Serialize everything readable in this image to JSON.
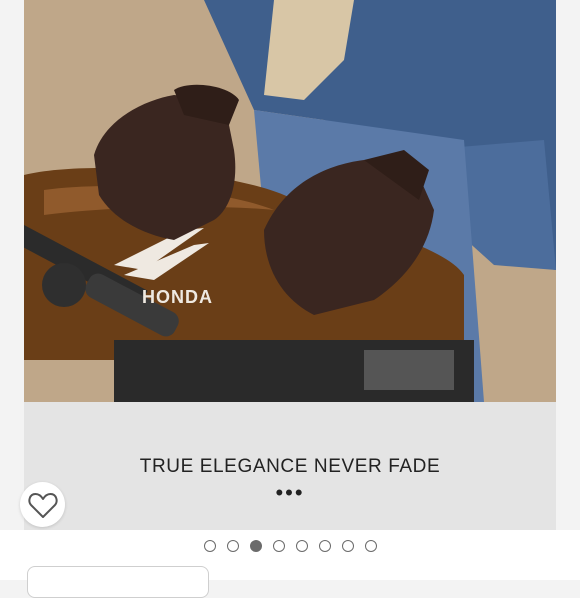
{
  "product": {
    "image": {
      "brand_text": "HONDA"
    },
    "caption": {
      "title": "TRUE ELEGANCE NEVER FADE",
      "more": "•••"
    },
    "favorite_icon": "heart-outline-icon",
    "carousel": {
      "total": 8,
      "active_index": 2
    }
  },
  "colors": {
    "caption_bg": "#e4e4e4",
    "text": "#222222",
    "dot": "#6b6b6b"
  }
}
